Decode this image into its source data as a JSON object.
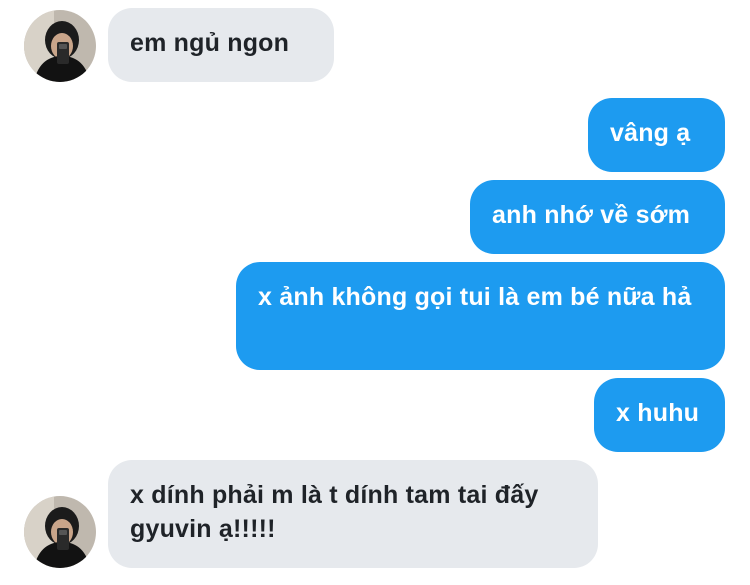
{
  "messages": [
    {
      "from": "contact",
      "text": "em ngủ ngon"
    },
    {
      "from": "me",
      "text": "vâng ạ"
    },
    {
      "from": "me",
      "text": "anh nhớ về sớm"
    },
    {
      "from": "me",
      "text": "x ảnh không gọi tui là em bé nữa hả"
    },
    {
      "from": "me",
      "text": "x huhu"
    },
    {
      "from": "contact",
      "text": "x dính phải m là t dính tam tai đấy gyuvin ạ!!!!!"
    }
  ],
  "colors": {
    "incoming_bubble": "#e6e9ed",
    "outgoing_bubble": "#1d9bf0",
    "incoming_text": "#1f2328",
    "outgoing_text": "#ffffff"
  },
  "icons": {
    "contact_avatar": "person-photo-avatar"
  }
}
